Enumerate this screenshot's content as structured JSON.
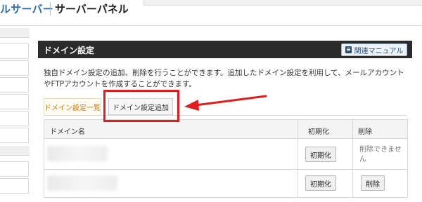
{
  "header": {
    "brand": "ルサーバー",
    "panel_name": "サーバーパネル"
  },
  "panel": {
    "title": "ドメイン設定",
    "manual_button": "関連マニュアル",
    "description": "独自ドメイン設定の追加、削除を行うことができます。追加したドメイン設定を利用して、メールアカウントやFTPアカウントを作成することができます。"
  },
  "tabs": {
    "list": "ドメイン設定一覧",
    "add": "ドメイン設定追加"
  },
  "table": {
    "headers": {
      "domain": "ドメイン名",
      "init": "初期化",
      "delete": "削除"
    },
    "rows": [
      {
        "init_button": "初期化",
        "delete_text": "削除できません"
      },
      {
        "init_button": "初期化",
        "delete_button": "削除"
      }
    ]
  },
  "colors": {
    "highlight": "#e01e1e",
    "panel_header": "#2b2b2b",
    "brand_blue": "#2d6db0",
    "active_tab_text": "#c87a1a"
  }
}
